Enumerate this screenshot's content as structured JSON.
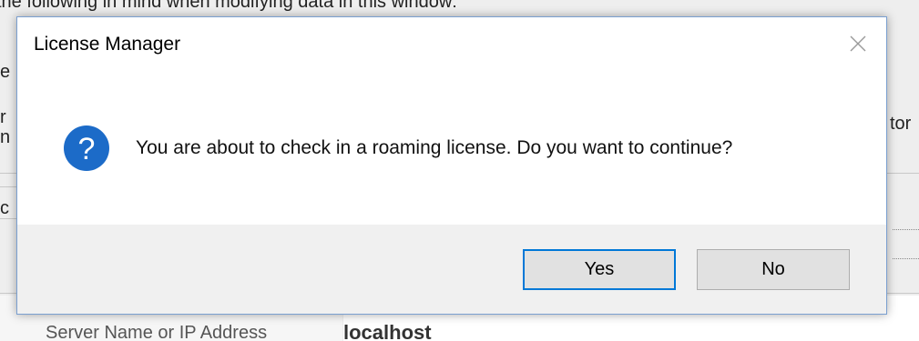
{
  "background": {
    "top_text": "the following in mind when modifying data in this window:",
    "left_fragments": [
      "e",
      "r",
      "n",
      "c"
    ],
    "right_fragment": "tor",
    "field_label": "Server Name or IP Address",
    "field_value": "localhost"
  },
  "dialog": {
    "title": "License Manager",
    "message": "You are about to check in a roaming license.  Do you want to continue?",
    "close_glyph": "✕",
    "icon_glyph": "?",
    "buttons": {
      "yes": "Yes",
      "no": "No"
    }
  },
  "colors": {
    "accent": "#0078d7",
    "question_icon": "#1c6bc8"
  }
}
